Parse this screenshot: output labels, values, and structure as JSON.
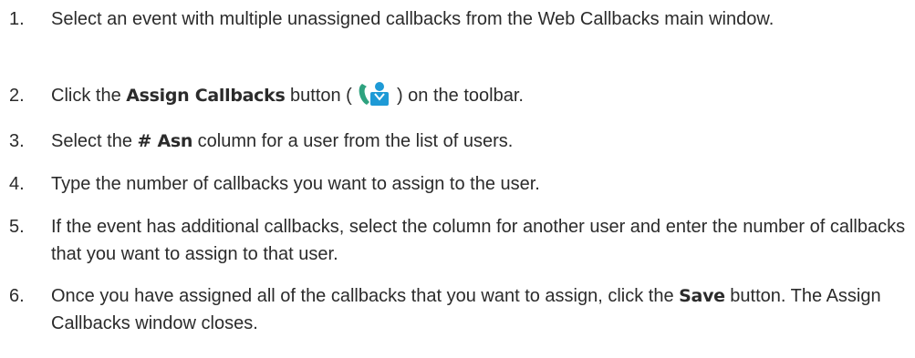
{
  "steps": [
    {
      "number": "1.",
      "text": "Select an event with multiple unassigned callbacks from the Web Callbacks main window."
    },
    {
      "number": "2.",
      "pre": "Click the ",
      "bold": "Assign Callbacks",
      "mid": " button ( ",
      "icon": "assign-callbacks-icon",
      "post": " ) on the toolbar."
    },
    {
      "number": "3.",
      "pre": "Select the ",
      "bold": "# Asn",
      "post": " column for a user from the list of users."
    },
    {
      "number": "4.",
      "text": "Type the number of callbacks you want to assign to the user."
    },
    {
      "number": "5.",
      "text": "If the event has additional callbacks, select the column for another user and enter the number of callbacks that you want to assign to that user."
    },
    {
      "number": "6.",
      "pre": "Once you have assigned all of the callbacks that you want to assign, click the ",
      "bold": "Save",
      "post": " button. The Assign Callbacks window closes."
    }
  ],
  "colors": {
    "text": "#2b2b2b",
    "phone_icon": "#2ea27f",
    "person_icon": "#1e9ad6"
  }
}
